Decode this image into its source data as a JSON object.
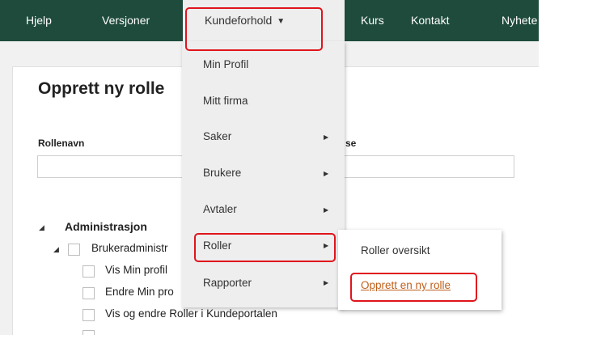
{
  "nav": {
    "items": [
      "Hjelp",
      "Versjoner",
      "Kurs",
      "Kontakt",
      "Nyhete"
    ],
    "active": "Kundeforhold",
    "active_caret": "▼"
  },
  "form": {
    "title": "Opprett ny rolle",
    "rollenavn_label": "Rollenavn",
    "beskrivelse_label_fragment": "se"
  },
  "tree": {
    "group": "Administrasjon",
    "subgroup": "Brukeradministr",
    "items": [
      "Vis Min profil",
      "Endre Min pro",
      "Vis og endre Roller i Kundeportalen"
    ]
  },
  "dropdown": {
    "items": [
      "Min Profil",
      "Mitt firma",
      "Saker",
      "Brukere",
      "Avtaler",
      "Roller",
      "Rapporter"
    ],
    "submenu_arrow": "▶"
  },
  "submenu": {
    "items": [
      "Roller oversikt",
      "Opprett en ny rolle"
    ]
  },
  "colors": {
    "nav_bg": "#1e4b3c",
    "highlight": "#e0141c",
    "link": "#c0601c"
  }
}
